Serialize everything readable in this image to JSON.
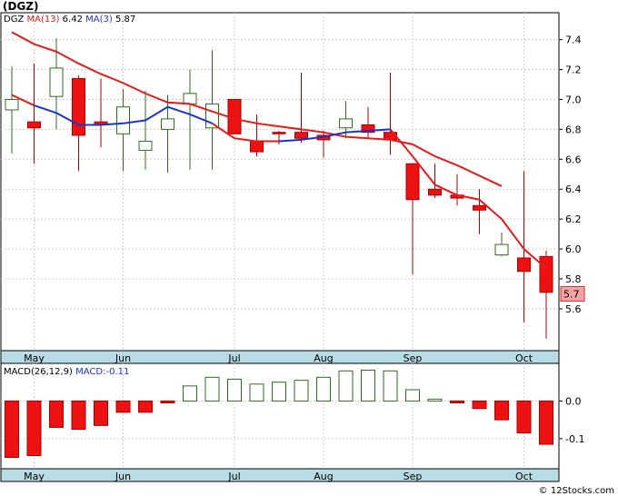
{
  "ticker_title": "(DGZ)",
  "footer": "© 12Stocks.com",
  "colors": {
    "up_fill": "#ffffff",
    "up_stroke": "#2e6b1e",
    "down_fill": "#ee1111",
    "down_stroke": "#aa0000",
    "ma13": "#e51a1a",
    "ma3": "#1a33cc",
    "axis_band": "#b8dce6",
    "grid": "#d0d0d0"
  },
  "chart_data": [
    {
      "type": "candlestick",
      "legend": [
        {
          "text": "DGZ",
          "color": "#000000"
        },
        {
          "text": "MA(13)",
          "color": "#e51a1a"
        },
        {
          "text": "6.42",
          "color": "#000000"
        },
        {
          "text": "MA(3)",
          "color": "#1a33cc"
        },
        {
          "text": "5.87",
          "color": "#000000"
        }
      ],
      "ylim": [
        5.32,
        7.58
      ],
      "yticks": [
        "7.4",
        "7.2",
        "7.0",
        "6.8",
        "6.6",
        "6.4",
        "6.2",
        "6.0",
        "5.8",
        "5.6"
      ],
      "last_price_label": "5.7",
      "last_price": 5.7,
      "x_labels": [
        "May",
        "Jun",
        "Jul",
        "Aug",
        "Sep",
        "Oct"
      ],
      "x_label_periods": [
        1,
        5,
        10,
        14,
        18,
        23
      ],
      "candles": [
        {
          "o": 6.93,
          "h": 7.22,
          "l": 6.64,
          "c": 7.0
        },
        {
          "o": 6.85,
          "h": 7.24,
          "l": 6.57,
          "c": 6.81
        },
        {
          "o": 7.02,
          "h": 7.41,
          "l": 6.8,
          "c": 7.21
        },
        {
          "o": 7.14,
          "h": 7.16,
          "l": 6.52,
          "c": 6.76
        },
        {
          "o": 6.85,
          "h": 7.14,
          "l": 6.68,
          "c": 6.83
        },
        {
          "o": 6.77,
          "h": 7.07,
          "l": 6.52,
          "c": 6.95
        },
        {
          "o": 6.66,
          "h": 7.06,
          "l": 6.53,
          "c": 6.72
        },
        {
          "o": 6.8,
          "h": 7.03,
          "l": 6.51,
          "c": 6.87
        },
        {
          "o": 6.97,
          "h": 7.2,
          "l": 6.53,
          "c": 7.04
        },
        {
          "o": 6.81,
          "h": 7.33,
          "l": 6.53,
          "c": 6.97
        },
        {
          "o": 7.0,
          "h": 7.0,
          "l": 6.77,
          "c": 6.77
        },
        {
          "o": 6.72,
          "h": 6.9,
          "l": 6.62,
          "c": 6.65
        },
        {
          "o": 6.78,
          "h": 6.79,
          "l": 6.7,
          "c": 6.77
        },
        {
          "o": 6.78,
          "h": 7.18,
          "l": 6.71,
          "c": 6.74
        },
        {
          "o": 6.76,
          "h": 6.79,
          "l": 6.61,
          "c": 6.73
        },
        {
          "o": 6.81,
          "h": 6.99,
          "l": 6.74,
          "c": 6.87
        },
        {
          "o": 6.83,
          "h": 6.95,
          "l": 6.74,
          "c": 6.78
        },
        {
          "o": 6.78,
          "h": 7.18,
          "l": 6.63,
          "c": 6.73
        },
        {
          "o": 6.57,
          "h": 6.57,
          "l": 5.83,
          "c": 6.33
        },
        {
          "o": 6.4,
          "h": 6.57,
          "l": 6.34,
          "c": 6.36
        },
        {
          "o": 6.36,
          "h": 6.5,
          "l": 6.29,
          "c": 6.34
        },
        {
          "o": 6.29,
          "h": 6.4,
          "l": 6.1,
          "c": 6.26
        },
        {
          "o": 5.96,
          "h": 6.11,
          "l": 5.95,
          "c": 6.03
        },
        {
          "o": 5.94,
          "h": 6.52,
          "l": 5.51,
          "c": 5.85
        },
        {
          "o": 5.95,
          "h": 5.99,
          "l": 5.4,
          "c": 5.71
        }
      ],
      "ma13": [
        7.45,
        7.37,
        7.32,
        7.24,
        7.17,
        7.11,
        7.04,
        6.98,
        6.97,
        6.92,
        6.87,
        6.84,
        6.82,
        6.8,
        6.78,
        6.75,
        6.74,
        6.73,
        6.7,
        6.62,
        6.56,
        6.49,
        6.42
      ],
      "ma13_start_period": 0,
      "ma3": [
        7.03,
        6.96,
        6.91,
        6.83,
        6.83,
        6.84,
        6.86,
        6.95,
        6.9,
        6.84,
        6.74,
        6.72,
        6.72,
        6.73,
        6.75,
        6.78,
        6.79,
        6.8,
        6.62,
        6.43,
        6.36,
        6.33,
        6.2,
        6.0,
        5.87
      ],
      "ma3_blue_periods": [
        1,
        9
      ],
      "ma3_blue_periods_2": [
        12,
        17
      ]
    },
    {
      "type": "bar",
      "title": "MACD(26,12,9)",
      "legend_value_label": "MACD:",
      "legend_value": "-0.11",
      "ylim": [
        -0.18,
        0.1
      ],
      "yticks": [
        "0.0",
        "-0.1"
      ],
      "ytick_values": [
        0.0,
        -0.1
      ],
      "values": [
        -0.15,
        -0.145,
        -0.07,
        -0.075,
        -0.065,
        -0.03,
        -0.03,
        -0.005,
        0.04,
        0.063,
        0.058,
        0.045,
        0.05,
        0.055,
        0.063,
        0.08,
        0.082,
        0.08,
        0.03,
        0.005,
        -0.005,
        -0.02,
        -0.05,
        -0.085,
        -0.115
      ]
    }
  ]
}
